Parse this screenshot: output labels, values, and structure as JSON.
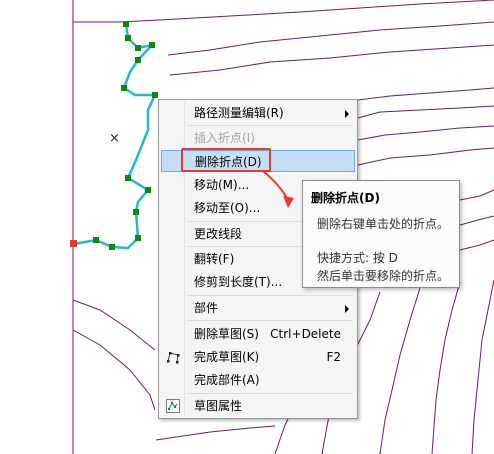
{
  "menu": {
    "items": [
      {
        "label": "路径测量编辑(R)",
        "submenu": true
      },
      {
        "label": "插入折点(I)",
        "disabled": true
      },
      {
        "label": "删除折点(D)",
        "highlighted": true
      },
      {
        "label": "移动(M)..."
      },
      {
        "label": "移动至(O)..."
      },
      {
        "label": "更改线段"
      },
      {
        "label": "翻转(F)"
      },
      {
        "label": "修剪到长度(T)..."
      },
      {
        "label": "部件",
        "submenu": true
      },
      {
        "label": "删除草图(S)",
        "shortcut": "Ctrl+Delete"
      },
      {
        "label": "完成草图(K)",
        "shortcut": "F2",
        "icon": "finish-sketch-icon"
      },
      {
        "label": "完成部件(A)"
      },
      {
        "label": "草图属性",
        "icon": "sketch-properties-icon"
      }
    ]
  },
  "tooltip": {
    "title": "删除折点(D)",
    "line1": "删除右键单击处的折点。",
    "line2": "快捷方式: 按 D",
    "line3": "然后单击要移除的折点。"
  },
  "map": {
    "cursor_glyph": "×",
    "colors": {
      "contour": "#6a1b6a",
      "sketch_line": "#29b6d6",
      "vertex": "#0a8a0a",
      "selected_vertex": "#e53935",
      "highlight_box": "#e53935"
    }
  }
}
